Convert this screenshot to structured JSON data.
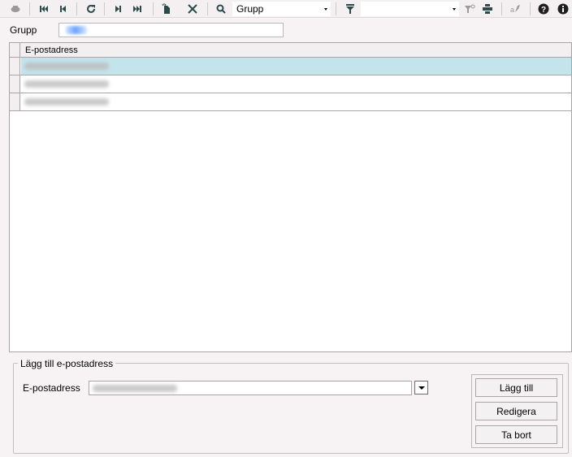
{
  "toolbar": {
    "icons": [
      "record-icon",
      "first-icon",
      "prev-icon",
      "refresh-icon",
      "next-icon",
      "last-icon",
      "new-icon",
      "delete-icon",
      "search-icon",
      "filter-icon",
      "clear-filter-icon",
      "print-icon",
      "spell-icon",
      "help-icon",
      "info-icon"
    ],
    "search_combo_value": "Grupp",
    "filter_combo_value": ""
  },
  "group": {
    "label": "Grupp"
  },
  "grid": {
    "column_header": "E-postadress",
    "rows": [
      {
        "active": true
      },
      {
        "active": false
      },
      {
        "active": false
      }
    ]
  },
  "add_section": {
    "title": "Lägg till e-postadress",
    "email_label": "E-postadress",
    "buttons": {
      "add": "Lägg till",
      "edit": "Redigera",
      "remove": "Ta bort"
    }
  },
  "colors": {
    "selected_row": "#c4e4ec",
    "toolbar_icon": "#2d4a4a"
  }
}
